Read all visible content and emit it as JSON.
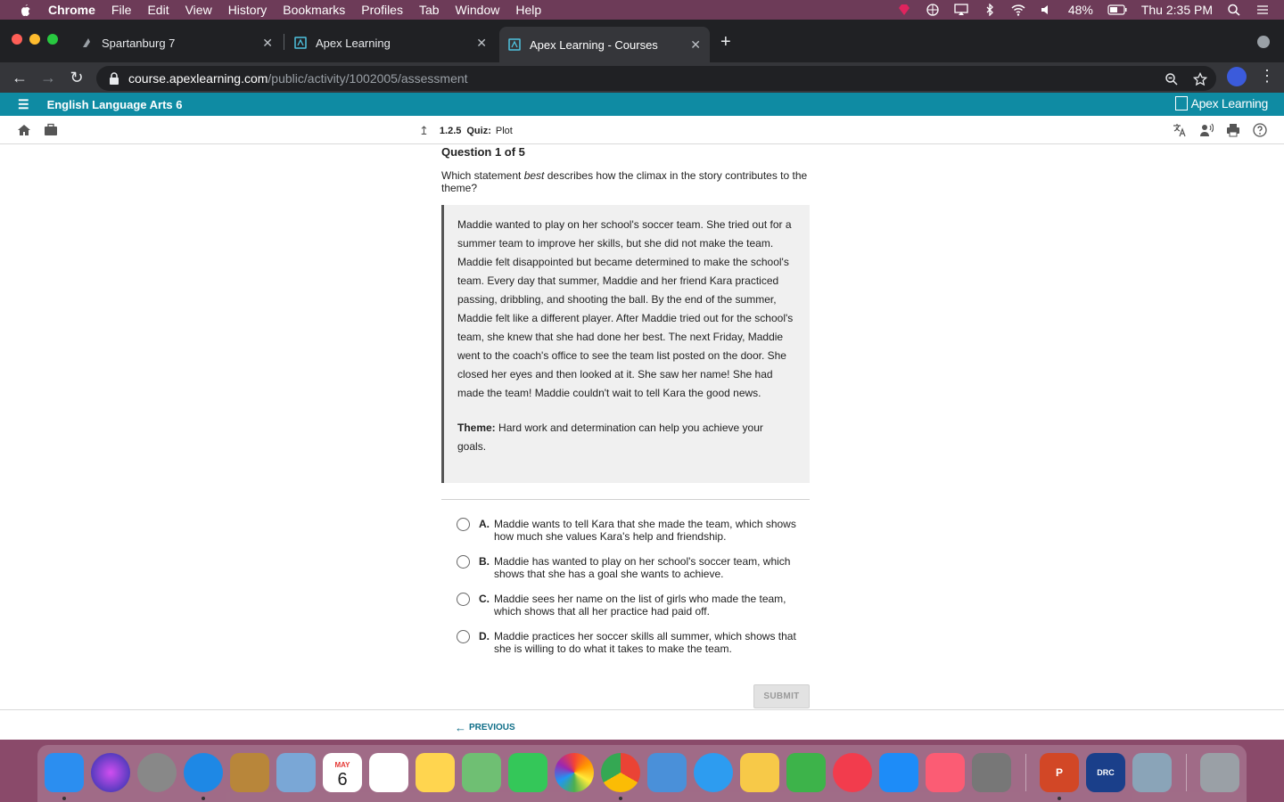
{
  "menubar": {
    "app_name": "Chrome",
    "items": [
      "File",
      "Edit",
      "View",
      "History",
      "Bookmarks",
      "Profiles",
      "Tab",
      "Window",
      "Help"
    ],
    "battery": "48%",
    "clock": "Thu 2:35 PM"
  },
  "tabs": [
    {
      "title": "Spartanburg 7"
    },
    {
      "title": "Apex Learning"
    },
    {
      "title": "Apex Learning - Courses"
    }
  ],
  "address": {
    "host": "course.apexlearning.com",
    "path": "/public/activity/1002005/assessment"
  },
  "course": {
    "title": "English Language Arts 6",
    "brand": "Apex Learning"
  },
  "breadcrumb": {
    "number": "1.2.5",
    "type": "Quiz:",
    "name": "Plot"
  },
  "question": {
    "counter": "Question 1 of 5",
    "prompt_before": "Which statement ",
    "prompt_emphasis": "best",
    "prompt_after": " describes how the climax in the story contributes to the theme?",
    "passage": "Maddie wanted to play on her school's soccer team. She tried out for a summer team to improve her skills, but she did not make the team. Maddie felt disappointed but became determined to make the school's team. Every day that summer, Maddie and her friend Kara practiced passing, dribbling, and shooting the ball. By the end of the summer, Maddie felt like a different player. After Maddie tried out for the school's team, she knew that she had done her best. The next Friday, Maddie went to the coach's office to see the team list posted on the door. She closed her eyes and then looked at it. She saw her name! She had made the team! Maddie couldn't wait to tell Kara the good news.",
    "theme_label": "Theme:",
    "theme_text": " Hard work and determination can help you achieve your goals.",
    "choices": [
      {
        "letter": "A.",
        "text": "Maddie wants to tell Kara that she made the team, which shows how much she values Kara's help and friendship."
      },
      {
        "letter": "B.",
        "text": "Maddie has wanted to play on her school's soccer team, which shows that she has a goal she wants to achieve."
      },
      {
        "letter": "C.",
        "text": "Maddie sees her name on the list of girls who made the team, which shows that all her practice had paid off."
      },
      {
        "letter": "D.",
        "text": "Maddie practices her soccer skills all summer, which shows that she is willing to do what it takes to make the team."
      }
    ],
    "submit_label": "SUBMIT"
  },
  "footer": {
    "previous_label": "PREVIOUS"
  },
  "dock": {
    "calendar_month": "MAY",
    "calendar_day": "6"
  },
  "colors": {
    "course_bar": "#0f8ba3",
    "link": "#0f6e88"
  }
}
